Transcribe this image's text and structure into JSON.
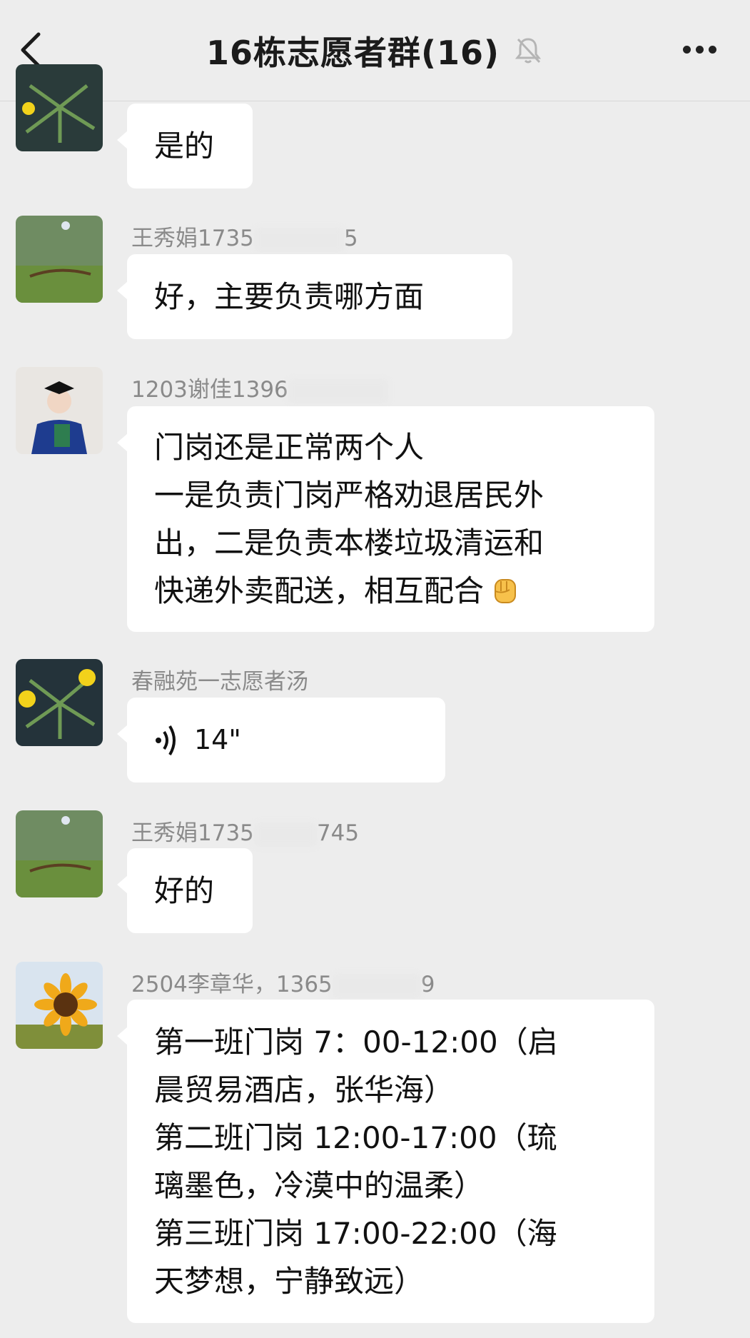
{
  "header": {
    "title": "16栋志愿者群(16)",
    "back_icon": "chevron-left-icon",
    "mute_icon": "bell-slash-icon",
    "more_icon": "ellipsis-icon"
  },
  "messages": [
    {
      "sender": "",
      "text_lines": [
        "是的"
      ]
    },
    {
      "sender_visible_start": "王秀娟1735",
      "sender_visible_end": "5",
      "text_lines": [
        "好，主要负责哪方面"
      ]
    },
    {
      "sender_visible_start": "1203谢佳1396",
      "sender_visible_end": "",
      "text_lines": [
        "门岗还是正常两个人",
        "一是负责门岗严格劝退居民外",
        "出，二是负责本楼垃圾清运和",
        "快递外卖配送，相互配合"
      ],
      "emoji": "fist-emoji"
    },
    {
      "sender": "春融苑一志愿者汤",
      "voice_duration": "14\""
    },
    {
      "sender_visible_start": "王秀娟1735",
      "sender_visible_end": "745",
      "text_lines": [
        "好的"
      ]
    },
    {
      "sender_visible_start": "2504李章华，1365",
      "sender_visible_end": "9",
      "text_lines": [
        "第一班门岗 7：00-12:00（启",
        "晨贸易酒店，张华海）",
        "第二班门岗 12:00-17:00（琉",
        "璃墨色，冷漠中的温柔）",
        "第三班门岗 17:00-22:00（海",
        "天梦想，宁静致远）"
      ]
    }
  ]
}
